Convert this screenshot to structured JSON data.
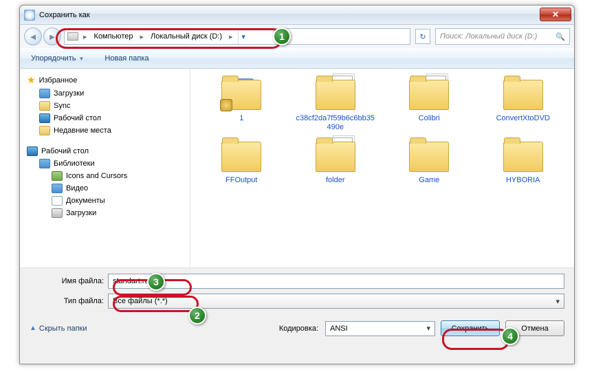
{
  "title": "Сохранить как",
  "breadcrumb": {
    "root": "Компьютер",
    "disk": "Локальный диск (D:)"
  },
  "search_placeholder": "Поиск: Локальный диск (D:)",
  "toolbar": {
    "organize": "Упорядочить",
    "newfolder": "Новая папка"
  },
  "tree": {
    "favorites": "Избранное",
    "downloads": "Загрузки",
    "sync": "Sync",
    "desktop": "Рабочий стол",
    "recent": "Недавние места",
    "desktop2": "Рабочий стол",
    "libraries": "Библиотеки",
    "icons": "Icons and Cursors",
    "video": "Видео",
    "docs": "Документы",
    "dl2": "Загрузки"
  },
  "folders": {
    "f1": "1",
    "f2": "c38cf2da7f59b6c6bb35490e",
    "f3": "Colibri",
    "f4": "ConvertXtoDVD",
    "f5": "FFOutput",
    "f6": "folder",
    "f7": "Game",
    "f8": "HYBORIA"
  },
  "fields": {
    "name_label": "Имя файла:",
    "name_value": "standart.reg",
    "type_label": "Тип файла:",
    "type_value": "Все файлы  (*.*)"
  },
  "footer": {
    "hide": "Скрыть папки",
    "encoding_label": "Кодировка:",
    "encoding_value": "ANSI",
    "save": "Сохранить",
    "cancel": "Отмена"
  },
  "badges": {
    "b1": "1",
    "b2": "2",
    "b3": "3",
    "b4": "4"
  }
}
